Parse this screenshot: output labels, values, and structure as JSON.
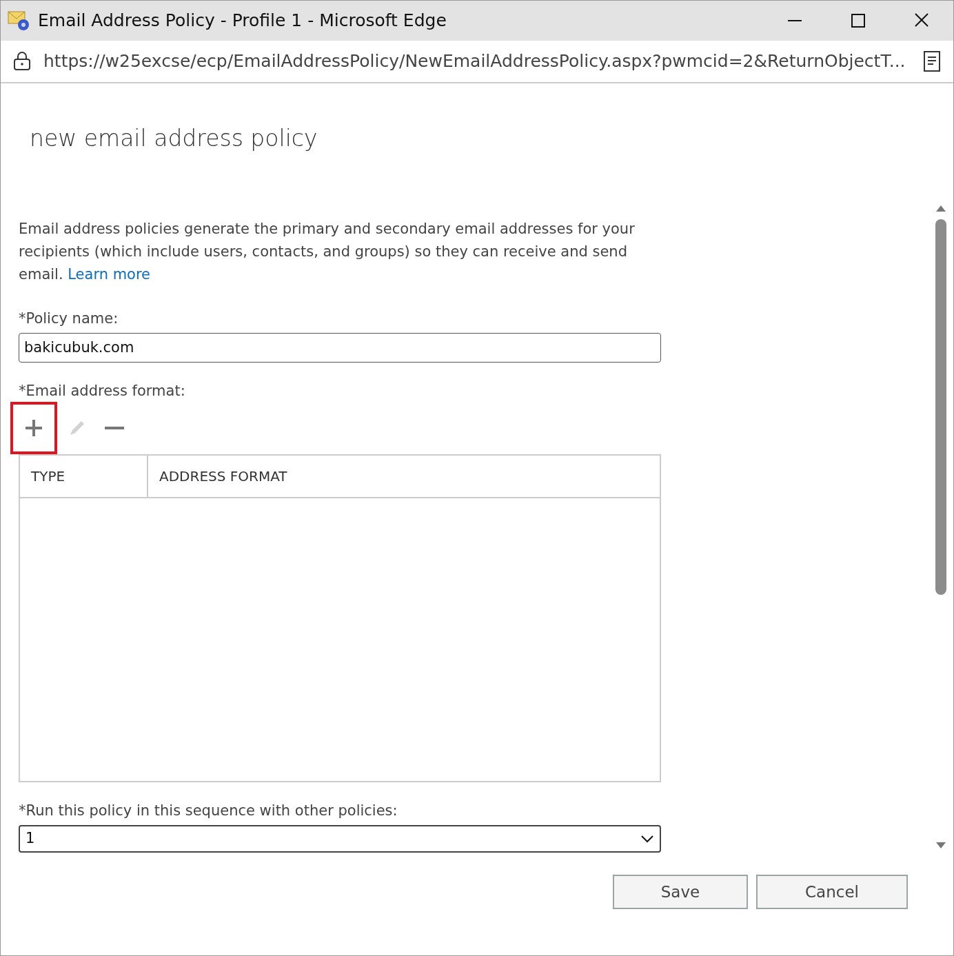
{
  "window": {
    "title": "Email Address Policy - Profile 1 - Microsoft Edge"
  },
  "address_bar": {
    "url": "https://w25excse/ecp/EmailAddressPolicy/NewEmailAddressPolicy.aspx?pwmcid=2&ReturnObjectT..."
  },
  "page": {
    "heading": "new email address policy",
    "description": "Email address policies generate the primary and secondary email addresses for your recipients (which include users, contacts, and groups) so they can receive and send email.",
    "learn_more": "Learn more",
    "policy_name": {
      "label": "*Policy name:",
      "value": "bakicubuk.com"
    },
    "address_format": {
      "label": "*Email address format:",
      "toolbar": [
        {
          "kind": "add",
          "disabled": false,
          "highlighted": true
        },
        {
          "kind": "edit",
          "disabled": true,
          "highlighted": false
        },
        {
          "kind": "remove",
          "disabled": false,
          "highlighted": false
        }
      ],
      "table": {
        "columns": [
          "TYPE",
          "ADDRESS FORMAT"
        ]
      }
    },
    "sequence": {
      "label": "*Run this policy in this sequence with other policies:",
      "value": "1"
    }
  },
  "buttons": [
    "Save",
    "Cancel"
  ]
}
